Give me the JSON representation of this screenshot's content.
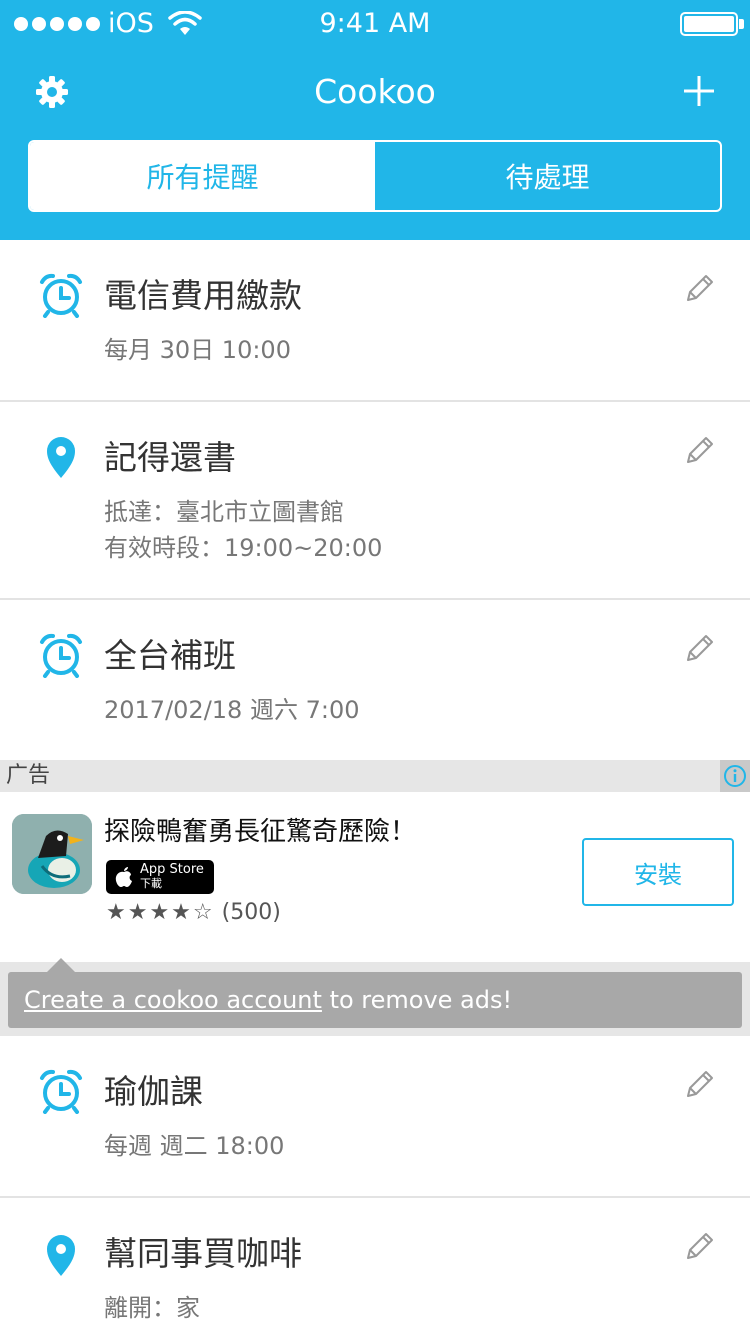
{
  "status_bar": {
    "carrier": "iOS",
    "time": "9:41 AM"
  },
  "nav": {
    "title": "Cookoo"
  },
  "tabs": [
    {
      "label": "所有提醒",
      "active": true
    },
    {
      "label": "待處理",
      "active": false
    }
  ],
  "reminders": [
    {
      "icon": "alarm-clock-icon",
      "title": "電信費用繳款",
      "lines": [
        "每月 30日 10:00"
      ]
    },
    {
      "icon": "location-pin-icon",
      "title": "記得還書",
      "lines": [
        "抵達：臺北市立圖書館",
        "有效時段：19:00~20:00"
      ]
    },
    {
      "icon": "alarm-clock-icon",
      "title": "全台補班",
      "lines": [
        "2017/02/18 週六 7:00"
      ]
    },
    {
      "icon": "alarm-clock-icon",
      "title": "瑜伽課",
      "lines": [
        "每週 週二 18:00"
      ]
    },
    {
      "icon": "location-pin-icon",
      "title": "幫同事買咖啡",
      "lines": [
        "離開：家"
      ]
    }
  ],
  "ad": {
    "label": "广告",
    "app_title": "探險鴨奮勇長征驚奇歷險！",
    "store_main": "App Store",
    "store_sub": "下載",
    "stars": "★★★★☆",
    "rating_count": "(500)",
    "install_label": "安裝"
  },
  "promo": {
    "link_text": "Create a cookoo account",
    "rest_text": " to remove ads!"
  },
  "colors": {
    "accent": "#21b6e8",
    "promo_bg": "#a8a8a8"
  }
}
